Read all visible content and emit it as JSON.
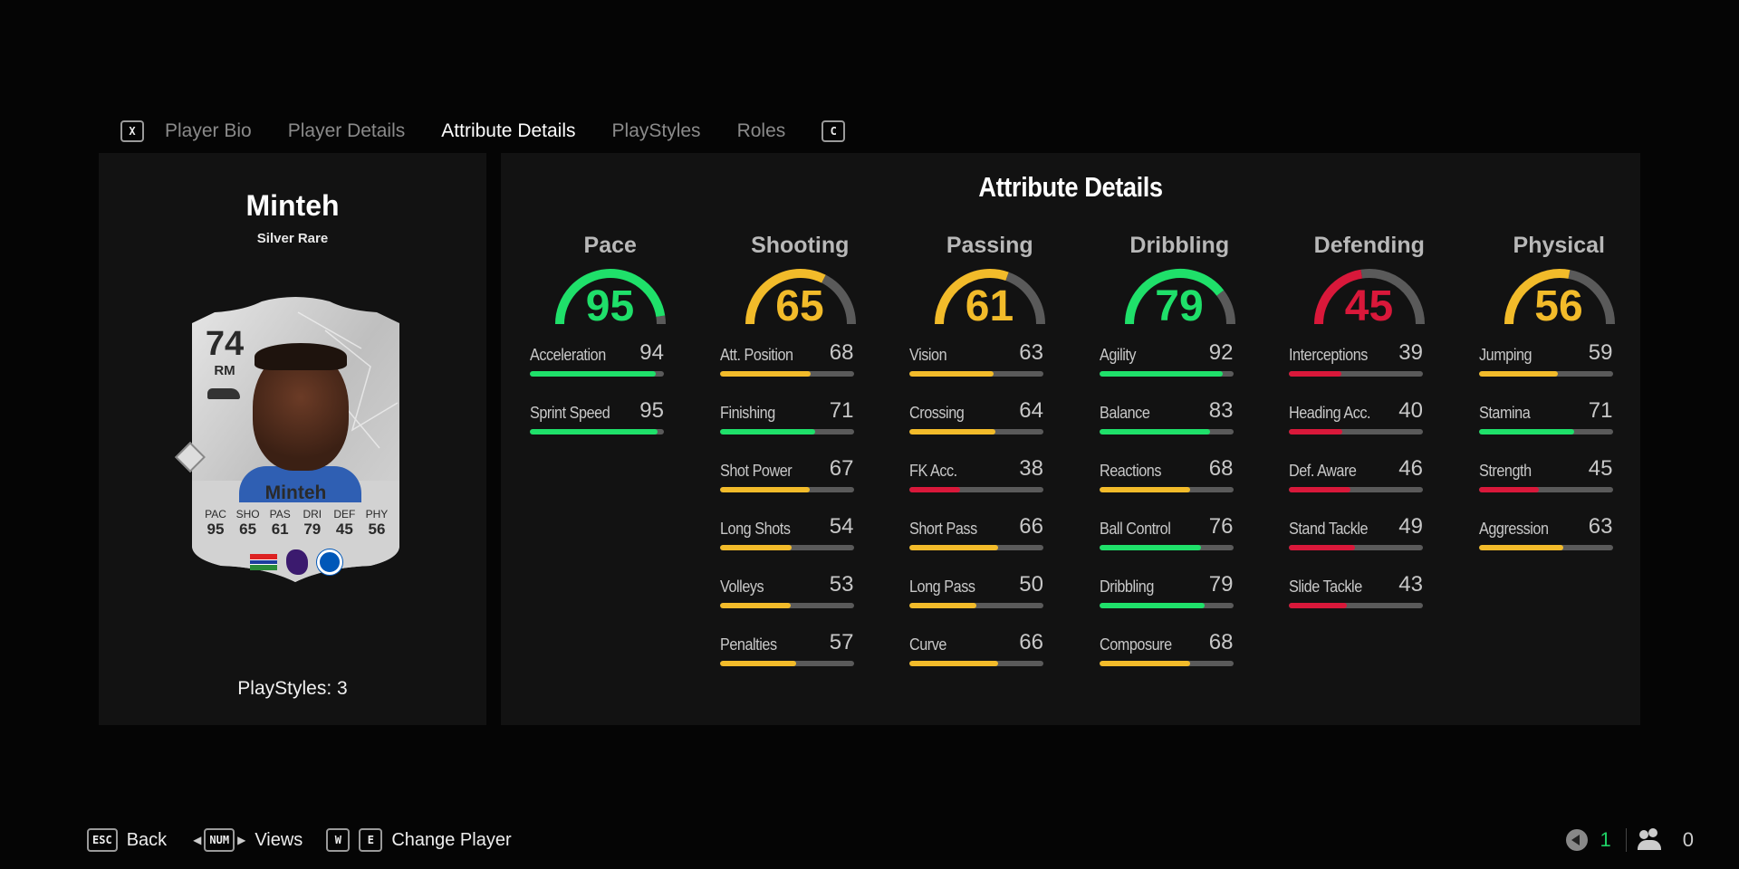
{
  "tabs": {
    "left_key": "X",
    "right_key": "C",
    "items": [
      {
        "label": "Player Bio",
        "active": false
      },
      {
        "label": "Player Details",
        "active": false
      },
      {
        "label": "Attribute Details",
        "active": true
      },
      {
        "label": "PlayStyles",
        "active": false
      },
      {
        "label": "Roles",
        "active": false
      }
    ]
  },
  "player": {
    "name": "Minteh",
    "rarity": "Silver Rare",
    "playstyles_label": "PlayStyles: 3",
    "card": {
      "rating": "74",
      "position": "RM",
      "name": "Minteh",
      "stats": [
        {
          "label": "PAC",
          "value": "95"
        },
        {
          "label": "SHO",
          "value": "65"
        },
        {
          "label": "PAS",
          "value": "61"
        },
        {
          "label": "DRI",
          "value": "79"
        },
        {
          "label": "DEF",
          "value": "45"
        },
        {
          "label": "PHY",
          "value": "56"
        }
      ]
    }
  },
  "colors": {
    "high": "#1fe06a",
    "mid": "#f2bb2a",
    "low": "#d9183a",
    "track": "#5a5a5a"
  },
  "attributes": {
    "title": "Attribute Details",
    "categories": [
      {
        "name": "Pace",
        "value": 95,
        "attrs": [
          {
            "name": "Acceleration",
            "value": 94
          },
          {
            "name": "Sprint Speed",
            "value": 95
          }
        ]
      },
      {
        "name": "Shooting",
        "value": 65,
        "attrs": [
          {
            "name": "Att. Position",
            "value": 68
          },
          {
            "name": "Finishing",
            "value": 71
          },
          {
            "name": "Shot Power",
            "value": 67
          },
          {
            "name": "Long Shots",
            "value": 54
          },
          {
            "name": "Volleys",
            "value": 53
          },
          {
            "name": "Penalties",
            "value": 57
          }
        ]
      },
      {
        "name": "Passing",
        "value": 61,
        "attrs": [
          {
            "name": "Vision",
            "value": 63
          },
          {
            "name": "Crossing",
            "value": 64
          },
          {
            "name": "FK Acc.",
            "value": 38
          },
          {
            "name": "Short Pass",
            "value": 66
          },
          {
            "name": "Long Pass",
            "value": 50
          },
          {
            "name": "Curve",
            "value": 66
          }
        ]
      },
      {
        "name": "Dribbling",
        "value": 79,
        "attrs": [
          {
            "name": "Agility",
            "value": 92
          },
          {
            "name": "Balance",
            "value": 83
          },
          {
            "name": "Reactions",
            "value": 68
          },
          {
            "name": "Ball Control",
            "value": 76
          },
          {
            "name": "Dribbling",
            "value": 79
          },
          {
            "name": "Composure",
            "value": 68
          }
        ]
      },
      {
        "name": "Defending",
        "value": 45,
        "attrs": [
          {
            "name": "Interceptions",
            "value": 39
          },
          {
            "name": "Heading Acc.",
            "value": 40
          },
          {
            "name": "Def. Aware",
            "value": 46
          },
          {
            "name": "Stand Tackle",
            "value": 49
          },
          {
            "name": "Slide Tackle",
            "value": 43
          }
        ]
      },
      {
        "name": "Physical",
        "value": 56,
        "attrs": [
          {
            "name": "Jumping",
            "value": 59
          },
          {
            "name": "Stamina",
            "value": 71
          },
          {
            "name": "Strength",
            "value": 45
          },
          {
            "name": "Aggression",
            "value": 63
          }
        ]
      }
    ]
  },
  "footer": {
    "back_key": "ESC",
    "back_label": "Back",
    "views_key": "NUM",
    "views_label": "Views",
    "prev_key": "W",
    "next_key": "E",
    "change_label": "Change Player"
  },
  "status": {
    "voice_count": "1",
    "party_count": "0"
  }
}
